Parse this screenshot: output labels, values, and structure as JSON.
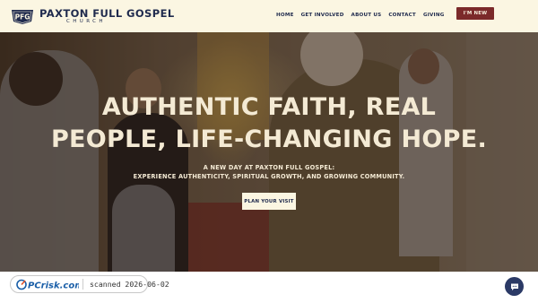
{
  "header": {
    "logo_badge": "PFG",
    "logo_title": "PAXTON FULL GOSPEL",
    "logo_subtitle": "CHURCH",
    "nav": [
      "HOME",
      "GET INVOLVED",
      "ABOUT US",
      "CONTACT",
      "GIVING"
    ],
    "cta_label": "I'M NEW"
  },
  "hero": {
    "headline_line1": "AUTHENTIC FAITH, REAL",
    "headline_line2": "PEOPLE, LIFE-CHANGING HOPE.",
    "sub_line1": "A NEW DAY AT PAXTON FULL GOSPEL:",
    "sub_line2": "EXPERIENCE AUTHENTICITY, SPIRITUAL GROWTH, AND GROWING COMMUNITY.",
    "button_label": "PLAN YOUR VISIT"
  },
  "footer": {
    "badge_logo": "PCrisk.com",
    "badge_text": "scanned 2026-06-02"
  },
  "colors": {
    "header_bg": "#fbf6e2",
    "navy": "#1f2a4d",
    "accent_red": "#7b2a2a",
    "hero_text": "#f4ead4",
    "chat_bg": "#2b3a66"
  },
  "icons": {
    "logo": "pfg-crest-icon",
    "chat": "chat-bubble-icon",
    "badge": "pcrisk-logo-icon"
  }
}
